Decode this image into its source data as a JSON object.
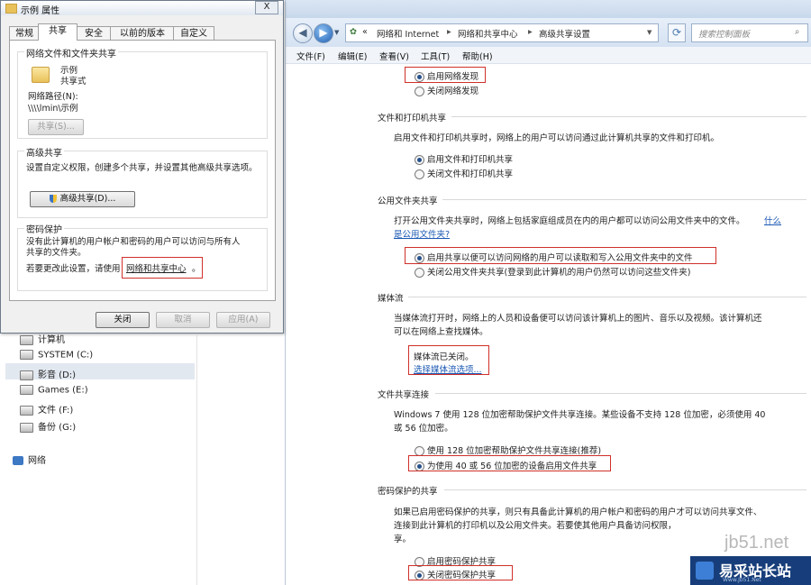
{
  "dialog": {
    "title": "示例 属性",
    "close": "X",
    "tabs": [
      "常规",
      "共享",
      "安全",
      "以前的版本",
      "自定义"
    ],
    "share_group": {
      "title": "网络文件和文件夹共享",
      "folder_name": "示例",
      "folder_status": "共享式",
      "path_label": "网络路径(N):",
      "path_value": "\\\\\\\\lmin\\示例",
      "share_button": "共享(S)..."
    },
    "advanced_group": {
      "title": "高级共享",
      "desc": "设置自定义权限，创建多个共享，并设置其他高级共享选项。",
      "button": "高级共享(D)..."
    },
    "password_group": {
      "title": "密码保护",
      "desc_line1": "没有此计算机的用户帐户和密码的用户可以访问与所有人",
      "desc_line2": "共享的文件夹。",
      "change_prefix": "若要更改此设置，请使用",
      "change_link": "网络和共享中心",
      "change_suffix": "。"
    },
    "buttons": {
      "close": "关闭",
      "cancel": "取消",
      "apply": "应用(A)"
    }
  },
  "nav_pane": {
    "computer": "计算机",
    "drives": [
      "SYSTEM (C:)",
      "影音 (D:)",
      "Games (E:)",
      "文件 (F:)",
      "备份 (G:)"
    ],
    "network": "网络"
  },
  "explorer": {
    "address": {
      "chevron": "«",
      "crumbs": [
        "网络和 Internet",
        "网络和共享中心",
        "高级共享设置"
      ]
    },
    "search_placeholder": "搜索控制面板",
    "menu": [
      "文件(F)",
      "编辑(E)",
      "查看(V)",
      "工具(T)",
      "帮助(H)"
    ],
    "discovery": {
      "on": "启用网络发现",
      "off": "关闭网络发现"
    },
    "file_printer": {
      "title": "文件和打印机共享",
      "desc": "启用文件和打印机共享时，网络上的用户可以访问通过此计算机共享的文件和打印机。",
      "on": "启用文件和打印机共享",
      "off": "关闭文件和打印机共享"
    },
    "public_folder": {
      "title": "公用文件夹共享",
      "desc": "打开公用文件夹共享时，网络上包括家庭组成员在内的用户都可以访问公用文件夹中的文件。",
      "link_part1": "什么",
      "link_part2": "是公用文件夹?",
      "on": "启用共享以便可以访问网络的用户可以读取和写入公用文件夹中的文件",
      "off": "关闭公用文件夹共享(登录到此计算机的用户仍然可以访问这些文件夹)"
    },
    "media": {
      "title": "媒体流",
      "desc_line1": "当媒体流打开时，网络上的人员和设备便可以访问该计算机上的图片、音乐以及视频。该计算机还",
      "desc_line2": "可以在网络上查找媒体。",
      "status": "媒体流已关闭。",
      "link": "选择媒体流选项..."
    },
    "file_share_conn": {
      "title": "文件共享连接",
      "desc_line1": "Windows 7 使用 128 位加密帮助保护文件共享连接。某些设备不支持 128 位加密，必须使用 40",
      "desc_line2": "或 56 位加密。",
      "opt128": "使用 128 位加密帮助保护文件共享连接(推荐)",
      "opt40": "为使用 40 或 56 位加密的设备启用文件共享"
    },
    "password_sharing": {
      "title": "密码保护的共享",
      "desc_line1": "如果已启用密码保护的共享，则只有具备此计算机的用户帐户和密码的用户才可以访问共享文件、",
      "desc_line2": "连接到此计算机的打印机以及公用文件夹。若要使其他用户具备访问权限，",
      "desc_line3": "享。",
      "on": "启用密码保护共享",
      "off": "关闭密码保护共享"
    }
  },
  "watermark": {
    "domain": "jb51.net",
    "site": "易采站长站",
    "tagline": "Www.Jb51.Net"
  }
}
